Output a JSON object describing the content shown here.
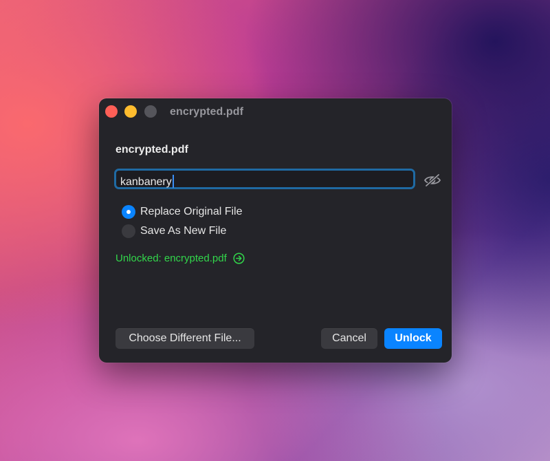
{
  "window": {
    "title": "encrypted.pdf"
  },
  "dialog": {
    "file_name": "encrypted.pdf",
    "password_field": {
      "value": "kanbanery",
      "reveal_icon": "eye-slash-icon"
    },
    "output_options": [
      {
        "label": "Replace Original File",
        "selected": true
      },
      {
        "label": "Save As New File",
        "selected": false
      }
    ],
    "status": {
      "text": "Unlocked: encrypted.pdf",
      "icon": "arrow-right-circle-icon",
      "color": "#32d74b"
    },
    "buttons": {
      "choose_label": "Choose Different File...",
      "cancel_label": "Cancel",
      "unlock_label": "Unlock"
    }
  },
  "colors": {
    "accent": "#0a84ff",
    "focus_ring": "#1f6aa3",
    "window_bg": "#242429",
    "traffic_close": "#fe5f57",
    "traffic_minimize": "#febc2e",
    "traffic_zoom_inactive": "#55555b"
  }
}
